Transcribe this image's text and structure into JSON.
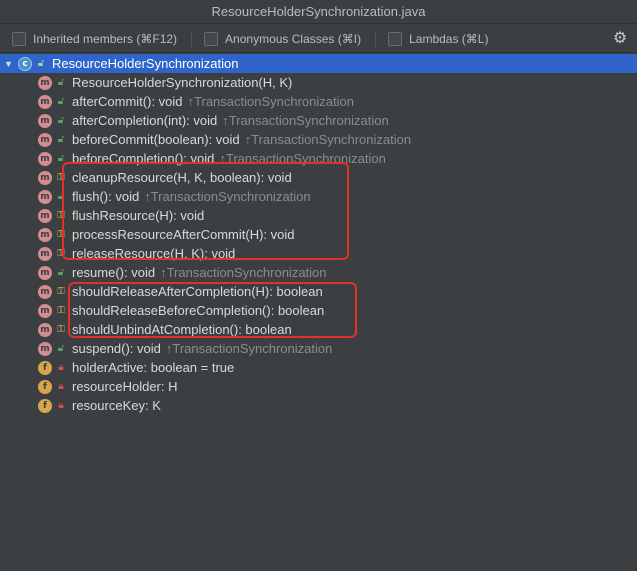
{
  "window": {
    "title": "ResourceHolderSynchronization.java"
  },
  "filters": [
    {
      "label": "Inherited members (⌘F12)"
    },
    {
      "label": "Anonymous Classes (⌘I)"
    },
    {
      "label": "Lambdas (⌘L)"
    }
  ],
  "settings_icon": "gear-icon",
  "tree": {
    "root": {
      "label": "ResourceHolderSynchronization",
      "icon": "class-icon"
    },
    "items": [
      {
        "kind": "m",
        "vis": "pub",
        "name": "ResourceHolderSynchronization(H, K)",
        "inherited": ""
      },
      {
        "kind": "m",
        "vis": "pub",
        "name": "afterCommit(): void",
        "inherited": "↑TransactionSynchronization"
      },
      {
        "kind": "m",
        "vis": "pub",
        "name": "afterCompletion(int): void",
        "inherited": "↑TransactionSynchronization"
      },
      {
        "kind": "m",
        "vis": "pub",
        "name": "beforeCommit(boolean): void",
        "inherited": "↑TransactionSynchronization"
      },
      {
        "kind": "m",
        "vis": "pub",
        "name": "beforeCompletion(): void",
        "inherited": "↑TransactionSynchronization"
      },
      {
        "kind": "m",
        "vis": "prot",
        "name": "cleanupResource(H, K, boolean): void",
        "inherited": ""
      },
      {
        "kind": "m",
        "vis": "pub",
        "name": "flush(): void",
        "inherited": "↑TransactionSynchronization"
      },
      {
        "kind": "m",
        "vis": "prot",
        "name": "flushResource(H): void",
        "inherited": ""
      },
      {
        "kind": "m",
        "vis": "prot",
        "name": "processResourceAfterCommit(H): void",
        "inherited": ""
      },
      {
        "kind": "m",
        "vis": "prot",
        "name": "releaseResource(H, K): void",
        "inherited": ""
      },
      {
        "kind": "m",
        "vis": "pub",
        "name": "resume(): void",
        "inherited": "↑TransactionSynchronization"
      },
      {
        "kind": "m",
        "vis": "prot",
        "name": "shouldReleaseAfterCompletion(H): boolean",
        "inherited": ""
      },
      {
        "kind": "m",
        "vis": "prot",
        "name": "shouldReleaseBeforeCompletion(): boolean",
        "inherited": ""
      },
      {
        "kind": "m",
        "vis": "prot",
        "name": "shouldUnbindAtCompletion(): boolean",
        "inherited": ""
      },
      {
        "kind": "m",
        "vis": "pub",
        "name": "suspend(): void",
        "inherited": "↑TransactionSynchronization"
      },
      {
        "kind": "f",
        "vis": "priv",
        "name": "holderActive: boolean = true",
        "inherited": ""
      },
      {
        "kind": "f",
        "vis": "priv",
        "name": "resourceHolder: H",
        "inherited": ""
      },
      {
        "kind": "f",
        "vis": "priv",
        "name": "resourceKey: K",
        "inherited": ""
      }
    ]
  },
  "colors": {
    "background": "#3c3f41",
    "selection": "#2f65ca",
    "highlight_box": "#e3302a",
    "method_icon": "#d38c91",
    "field_icon": "#d8a64a"
  }
}
